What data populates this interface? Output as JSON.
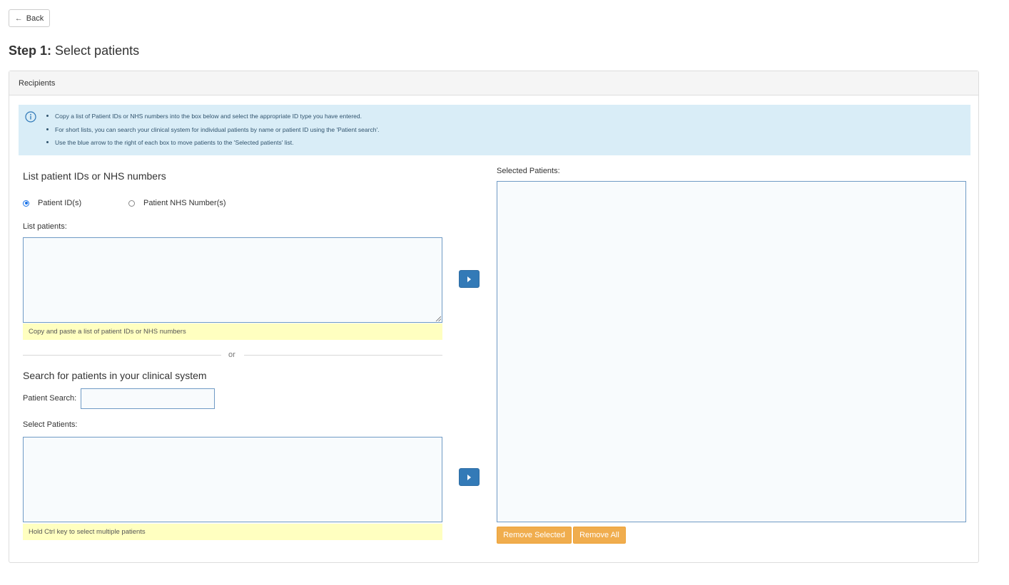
{
  "back_button": {
    "label": "Back",
    "icon": "arrow-left-icon"
  },
  "page_title": {
    "step": "Step 1:",
    "text": "Select patients"
  },
  "panel": {
    "heading": "Recipients",
    "info": {
      "icon": "info-circle-icon",
      "items": [
        "Copy a list of Patient IDs or NHS numbers into the box below and select the appropriate ID type you have entered.",
        "For short lists, you can search your clinical system for individual patients by name or patient ID using the 'Patient search'.",
        "Use the blue arrow to the right of each box to move patients to the 'Selected patients' list."
      ]
    }
  },
  "list_section": {
    "title": "List patient IDs or NHS numbers",
    "radio_options": [
      {
        "label": "Patient ID(s)",
        "checked": true
      },
      {
        "label": "Patient NHS Number(s)",
        "checked": false
      }
    ],
    "field_label": "List patients:",
    "textarea_value": "",
    "hint": "Copy and paste a list of patient IDs or NHS numbers"
  },
  "divider": {
    "text": "or"
  },
  "search_section": {
    "title": "Search for patients in your clinical system",
    "search_label": "Patient Search:",
    "search_value": "",
    "select_label": "Select Patients:",
    "hint": "Hold Ctrl key to select multiple patients"
  },
  "selected_section": {
    "label": "Selected Patients:",
    "remove_selected_label": "Remove Selected",
    "remove_all_label": "Remove All"
  },
  "colors": {
    "primary": "#337ab7",
    "warning": "#f0ad4e",
    "info_bg": "#d9edf7",
    "hint_bg": "#ffffc0"
  }
}
